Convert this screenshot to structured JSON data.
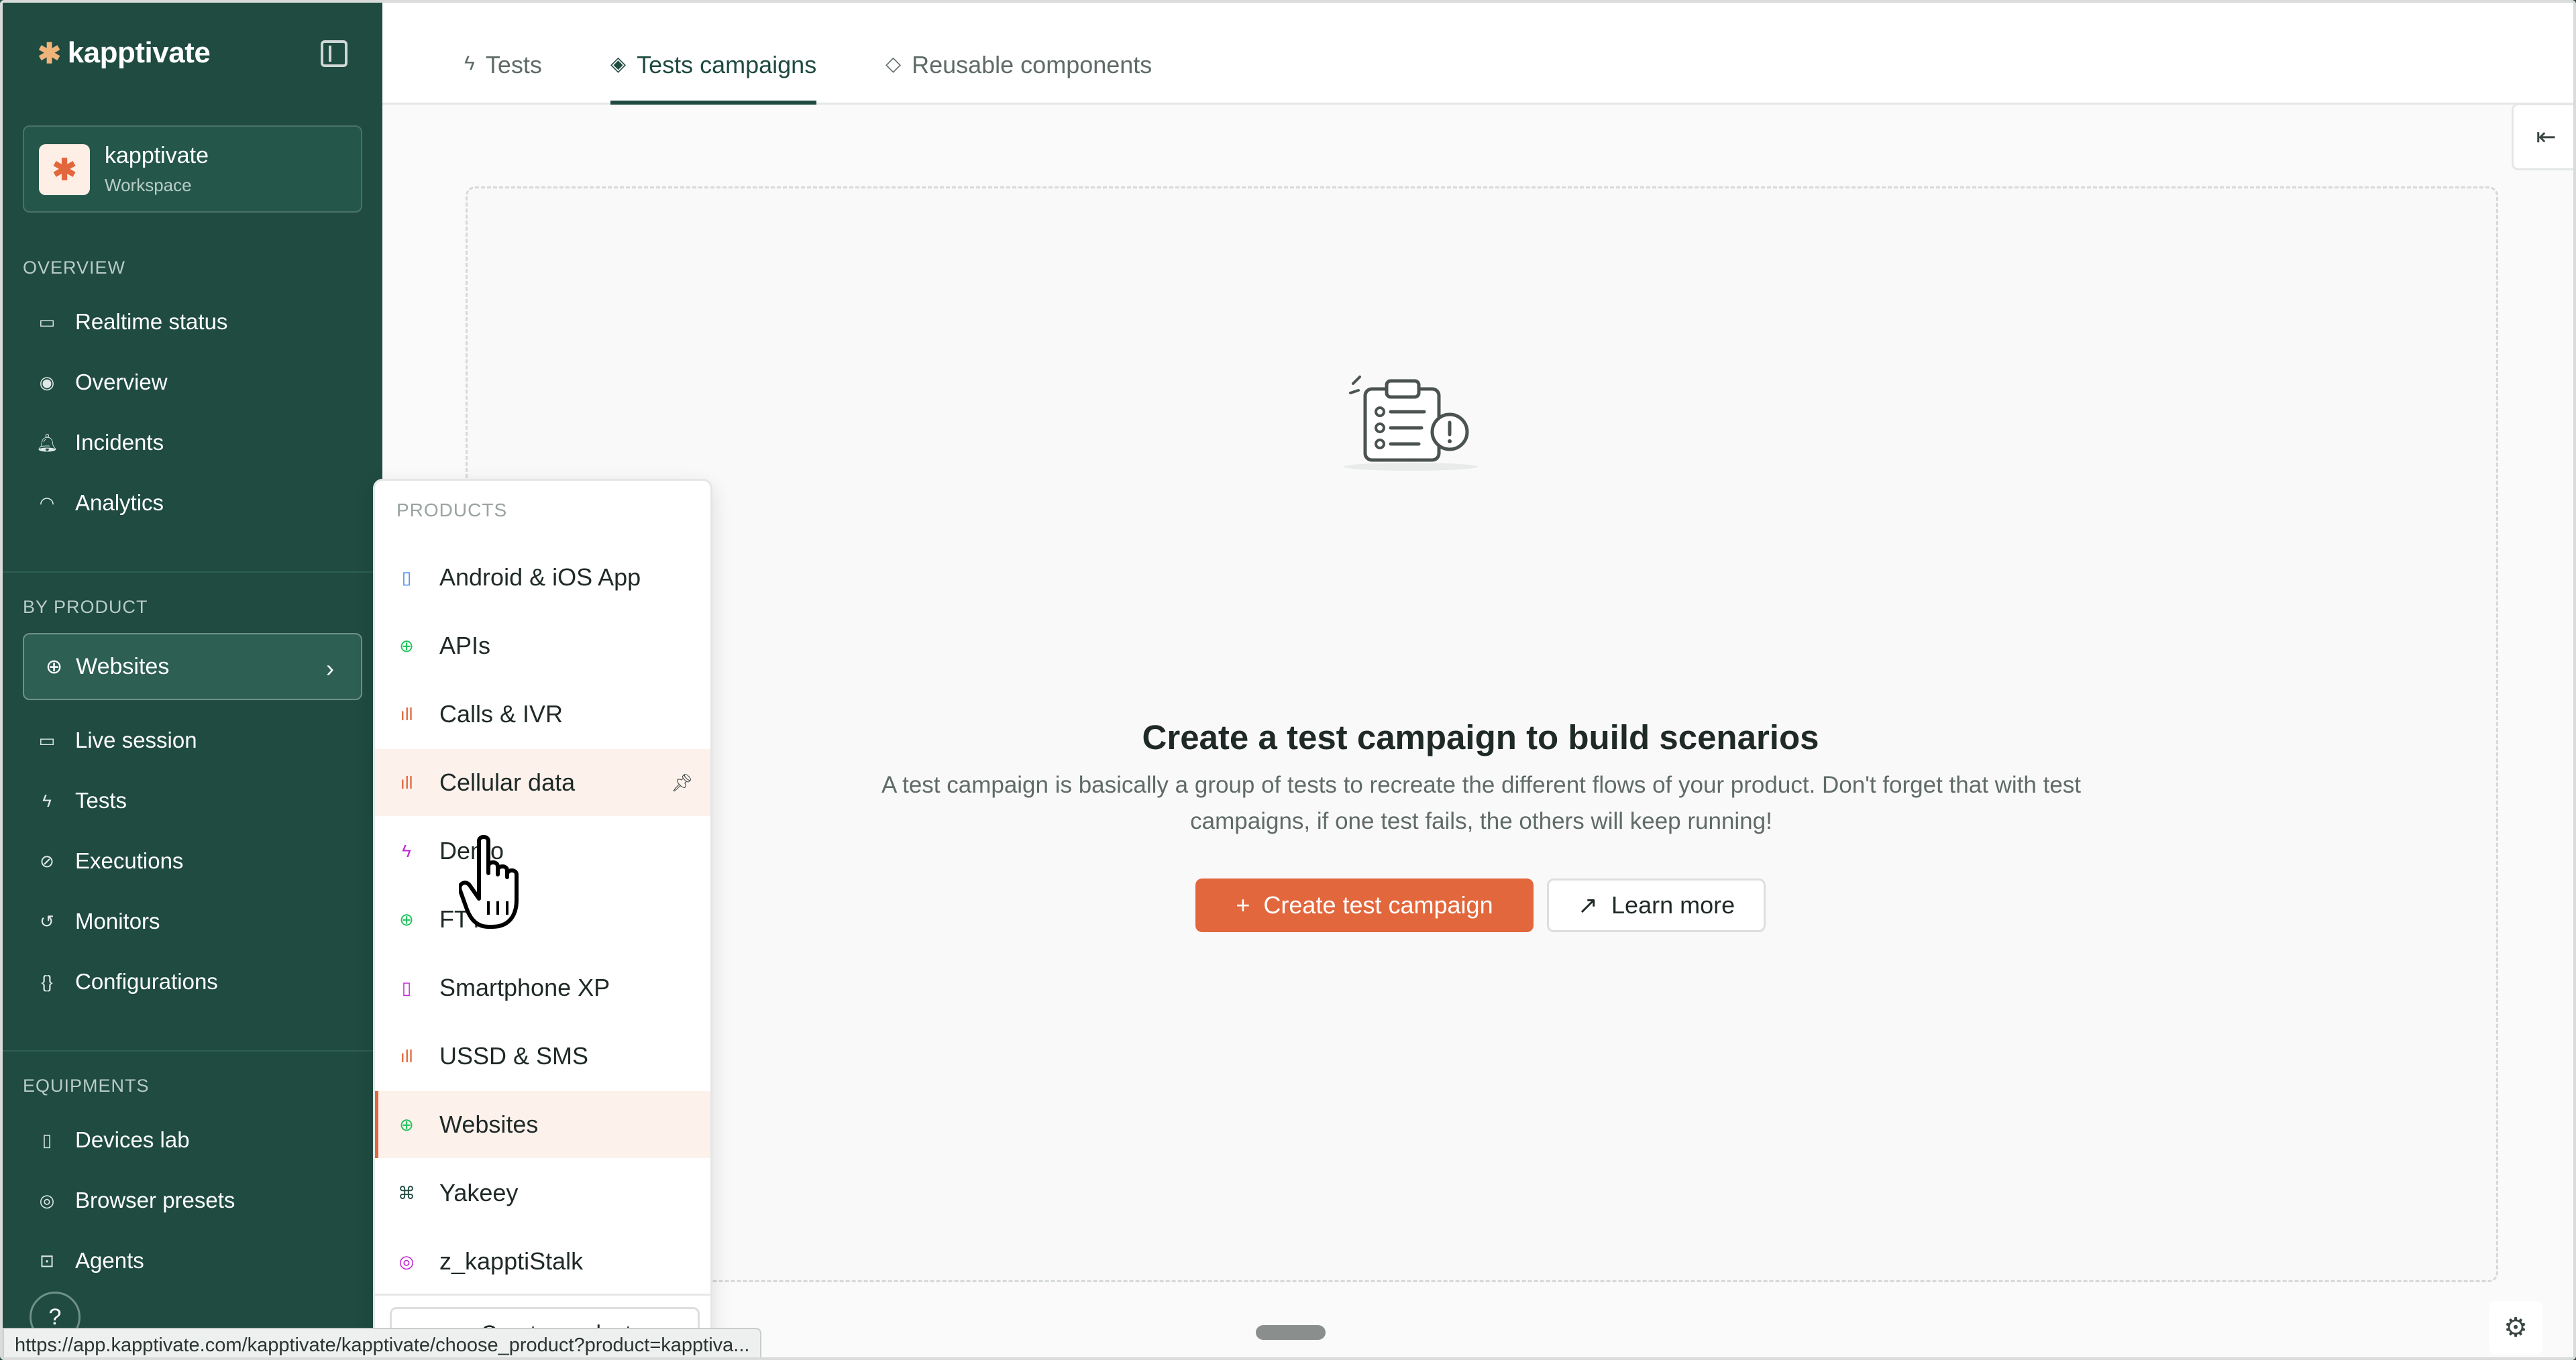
{
  "app": {
    "logo_text": "kapptivate",
    "brand_color": "#e2673d",
    "sidebar_color": "#1f4b40"
  },
  "workspace": {
    "avatar_glyph": "✱",
    "name": "kapptivate",
    "type": "Workspace"
  },
  "sidebar": {
    "overview_label": "OVERVIEW",
    "overview_items": [
      {
        "label": "Realtime status",
        "icon": "monitor-icon"
      },
      {
        "label": "Overview",
        "icon": "eye-icon"
      },
      {
        "label": "Incidents",
        "icon": "bell-icon"
      },
      {
        "label": "Analytics",
        "icon": "gauge-icon"
      }
    ],
    "by_product_label": "BY PRODUCT",
    "product_select": {
      "value": "Websites",
      "icon": "globe-icon"
    },
    "product_items": [
      {
        "label": "Live session",
        "icon": "screen-cast-icon"
      },
      {
        "label": "Tests",
        "icon": "bolt-icon"
      },
      {
        "label": "Executions",
        "icon": "check-circle-icon"
      },
      {
        "label": "Monitors",
        "icon": "history-icon"
      },
      {
        "label": "Configurations",
        "icon": "braces-icon"
      }
    ],
    "equipments_label": "EQUIPMENTS",
    "equipment_items": [
      {
        "label": "Devices lab",
        "icon": "phone-icon"
      },
      {
        "label": "Browser presets",
        "icon": "chrome-icon"
      },
      {
        "label": "Agents",
        "icon": "robot-icon"
      }
    ],
    "help_label": "?"
  },
  "tabs": [
    {
      "label": "Tests",
      "icon": "bolt-icon",
      "active": false
    },
    {
      "label": "Tests campaigns",
      "icon": "layers-icon",
      "active": true
    },
    {
      "label": "Reusable components",
      "icon": "components-icon",
      "active": false
    }
  ],
  "empty_state": {
    "title": "Create a test campaign to build scenarios",
    "description": "A test campaign is basically a group of tests to recreate the different flows of your product. Don't forget that with test campaigns, if one test fails, the others will keep running!",
    "primary_button": "Create test campaign",
    "primary_button_icon": "+",
    "secondary_button": "Learn more"
  },
  "dropdown": {
    "header": "PRODUCTS",
    "items": [
      {
        "label": "Android & iOS App",
        "icon": "phone-icon",
        "color": "#3b82f6"
      },
      {
        "label": "APIs",
        "icon": "globe-icon",
        "color": "#22c55e"
      },
      {
        "label": "Calls & IVR",
        "icon": "signal-icon",
        "color": "#e2673d"
      },
      {
        "label": "Cellular data",
        "icon": "signal-icon",
        "color": "#e2673d",
        "hover": true,
        "pinned": true
      },
      {
        "label": "Demo",
        "icon": "bolt-icon",
        "color": "#c026d3"
      },
      {
        "label": "FTTx",
        "icon": "globe-icon",
        "color": "#22c55e"
      },
      {
        "label": "Smartphone XP",
        "icon": "phone-icon",
        "color": "#c026d3"
      },
      {
        "label": "USSD & SMS",
        "icon": "signal-icon",
        "color": "#e2673d"
      },
      {
        "label": "Websites",
        "icon": "globe-icon",
        "color": "#22c55e",
        "selected": true
      },
      {
        "label": "Yakeey",
        "icon": "command-icon",
        "color": "#1f4b40"
      },
      {
        "label": "z_kapptiStalk",
        "icon": "support-icon",
        "color": "#c026d3"
      }
    ],
    "create_label": "Create product"
  },
  "status_url": "https://app.kapptivate.com/kapptivate/kapptivate/choose_product?product=kapptiva..."
}
